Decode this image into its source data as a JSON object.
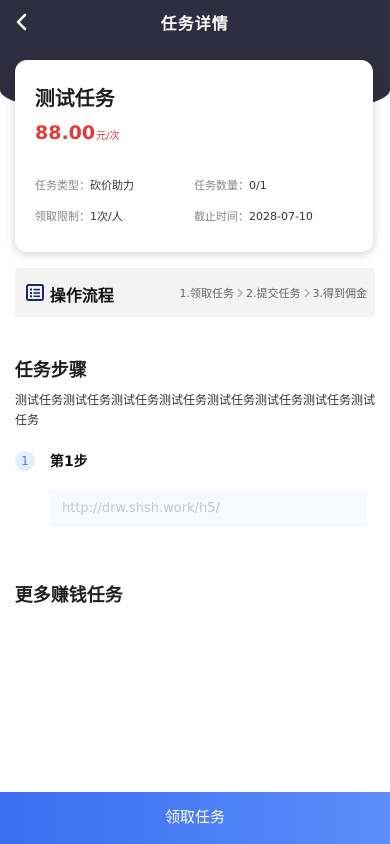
{
  "header": {
    "title": "任务详情"
  },
  "task": {
    "name": "测试任务",
    "price": "88.00",
    "price_unit": "元/次",
    "type_label": "任务类型：",
    "type_value": "砍价助力",
    "count_label": "任务数量：",
    "count_value": "0/1",
    "limit_label": "领取限制：",
    "limit_value": "1次/人",
    "deadline_label": "截止时间：",
    "deadline_value": "2028-07-10"
  },
  "flow": {
    "title": "操作流程",
    "steps": [
      "1.领取任务",
      "2.提交任务",
      "3.得到佣金"
    ]
  },
  "steps_section": {
    "title": "任务步骤",
    "description": "测试任务测试任务测试任务测试任务测试任务测试任务测试任务测试任务",
    "items": [
      {
        "number": "1",
        "title": "第1步",
        "url": "http://drw.shsh.work/h5/"
      }
    ]
  },
  "more": {
    "title": "更多赚钱任务"
  },
  "footer": {
    "button_label": "领取任务"
  },
  "colors": {
    "header_bg": "#2f2d40",
    "price": "#e23b3b",
    "accent": "#3b6df0"
  }
}
